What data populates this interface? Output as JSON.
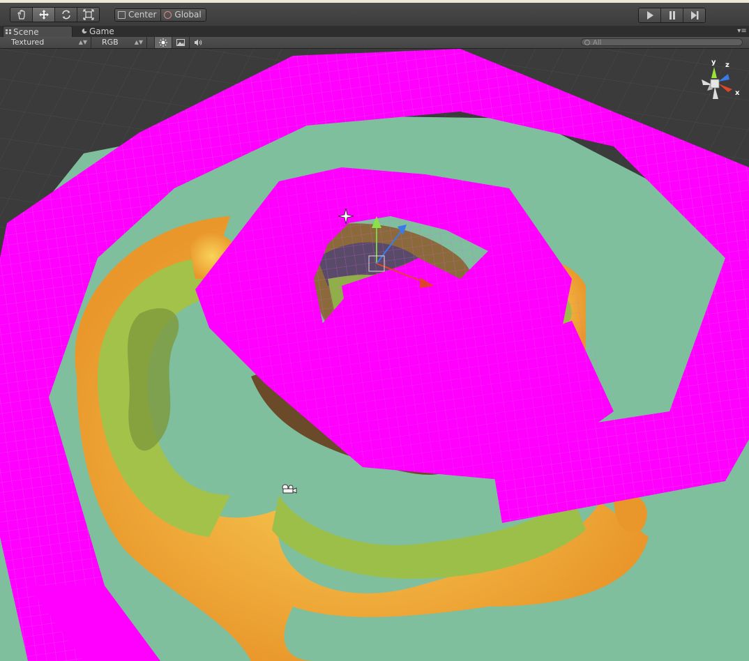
{
  "toolbar": {
    "tools": [
      {
        "name": "hand-tool-button",
        "icon": "hand-icon"
      },
      {
        "name": "move-tool-button",
        "icon": "move-arrows-icon"
      },
      {
        "name": "rotate-tool-button",
        "icon": "rotate-icon"
      },
      {
        "name": "scale-tool-button",
        "icon": "scale-icon"
      }
    ],
    "pivot_label": "Center",
    "space_label": "Global",
    "play_icons": [
      "play-icon",
      "pause-icon",
      "step-icon"
    ]
  },
  "tabs": [
    {
      "label": "Scene",
      "selected": true,
      "icon": "scene-icon"
    },
    {
      "label": "Game",
      "selected": false,
      "icon": "game-icon"
    }
  ],
  "scene_bar": {
    "render_mode": "Textured",
    "color_mode": "RGB",
    "toggles": [
      "lighting-icon",
      "image-effects-icon",
      "audio-icon"
    ],
    "search_placeholder": "All"
  },
  "gizmo": {
    "labels": {
      "y": "y",
      "z": "z",
      "x": "x"
    },
    "colors": {
      "x": "#e0452a",
      "y": "#9be23a",
      "z": "#3a7bea"
    }
  },
  "colors": {
    "missing_material": "#ff00ff",
    "water": "#7fc2a0",
    "sand": "#f3b43a",
    "grass": "#9cbf4a"
  }
}
